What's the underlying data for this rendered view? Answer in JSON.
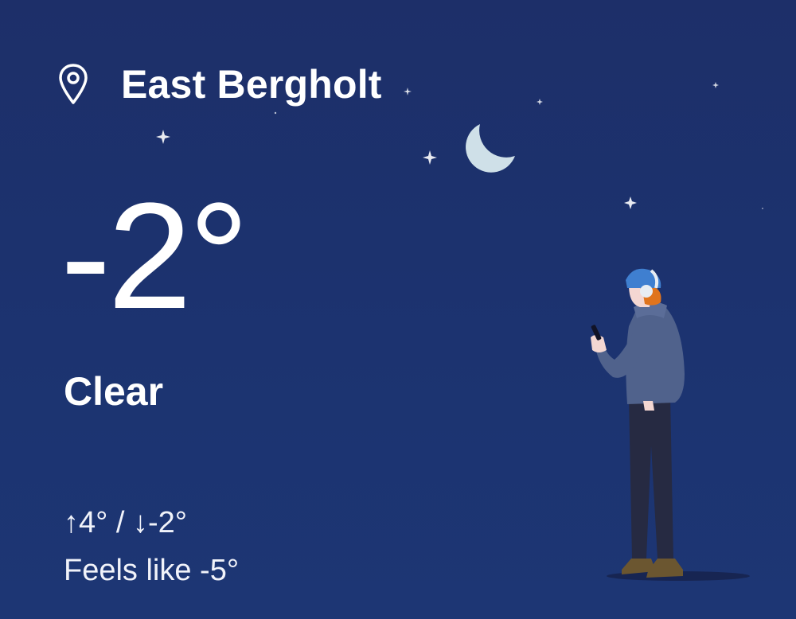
{
  "weather": {
    "location": "East Bergholt",
    "temperature": "-2°",
    "condition": "Clear",
    "high_low": "↑4° / ↓-2°",
    "feels_like": "Feels like -5°"
  },
  "icons": {
    "location": "location-pin-icon",
    "moon": "crescent-moon-icon",
    "stars": "star-icon"
  },
  "colors": {
    "background_top": "#1d2f69",
    "background_bottom": "#1d3674",
    "text": "#ffffff",
    "moon": "#cfe0e8",
    "hat": "#3f7fd0",
    "hair": "#e0741d",
    "coat": "#50628c",
    "trousers": "#262a42",
    "shoes": "#6b5630"
  }
}
